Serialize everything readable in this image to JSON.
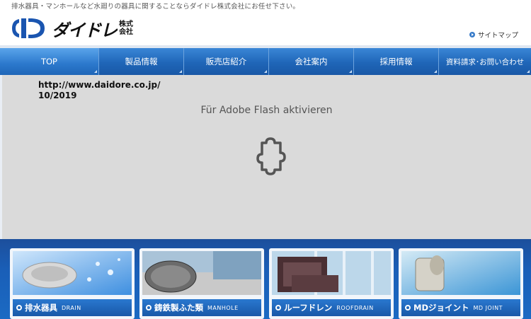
{
  "header": {
    "tagline": "排水器具・マンホールなど水廻りの器具に関することならダイドレ株式会社にお任せ下さい。",
    "logo_text": "ダイドレ",
    "logo_sub_top": "株式",
    "logo_sub_bottom": "会社",
    "sitemap_label": "サイトマップ"
  },
  "nav": {
    "items": [
      {
        "label": "TOP"
      },
      {
        "label": "製品情報"
      },
      {
        "label": "販売店紹介"
      },
      {
        "label": "会社案内"
      },
      {
        "label": "採用情報"
      },
      {
        "label": "資料請求･お問い合わせ"
      }
    ]
  },
  "overlay": {
    "url": "http://www.daidore.co.jp/",
    "date": "10/2019"
  },
  "flash": {
    "message": "Für Adobe Flash aktivieren",
    "icon": "puzzle-icon"
  },
  "cards": [
    {
      "label": "排水器具",
      "en": "DRAIN"
    },
    {
      "label": "鋳鉄製ふた類",
      "en": "MANHOLE"
    },
    {
      "label": "ルーフドレン",
      "en": "ROOFDRAIN"
    },
    {
      "label": "MDジョイント",
      "en": "MD JOINT"
    }
  ],
  "colors": {
    "nav_blue": "#1f66b8",
    "logo_blue": "#1a55b0",
    "flash_bg": "#dadada"
  }
}
